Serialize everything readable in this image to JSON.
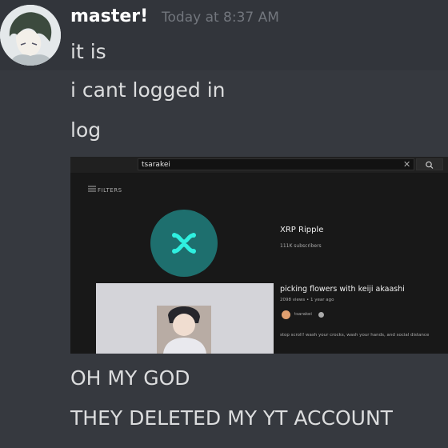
{
  "message": {
    "username": "master!",
    "timestamp": "Today at 8:37 AM",
    "lines": [
      "it is",
      "i cant logged in",
      "log",
      "OH MY GOD",
      "THEY DELETED MY YT ACCOUNT"
    ]
  },
  "attachment": {
    "search_query": "tsarakei",
    "clear_icon": "✕",
    "filters_label": "FILTERS",
    "channel": {
      "name": "XRP Ripple",
      "subscribers": "111K subscribers"
    },
    "video": {
      "title": "picking flowers with keiji akaashi",
      "meta": "2098 views • 1 year ago",
      "channel_name": "tsarakei",
      "description": "stop scroll! wash your crocks, wash your hands, and social distance"
    }
  },
  "colors": {
    "background": "#36393f",
    "hover_background": "#32353b",
    "username": "#ffffff",
    "timestamp": "#72767d",
    "message_text": "#dcddde",
    "xrp_teal": "#1e6f6e"
  },
  "icons": {
    "filter": "filter-icon",
    "search": "search-icon",
    "clear": "close-icon",
    "xrp_logo": "xrp-logo-icon",
    "verified": "verified-icon"
  }
}
